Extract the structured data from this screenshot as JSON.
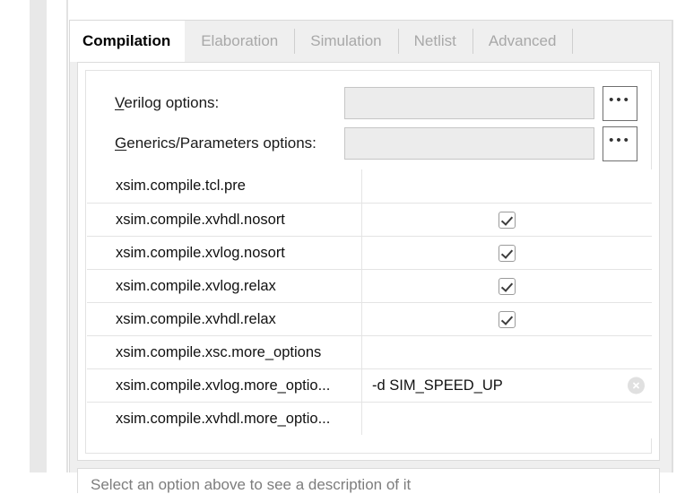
{
  "tabs": [
    {
      "label": "Compilation",
      "active": true
    },
    {
      "label": "Elaboration",
      "active": false
    },
    {
      "label": "Simulation",
      "active": false
    },
    {
      "label": "Netlist",
      "active": false
    },
    {
      "label": "Advanced",
      "active": false
    }
  ],
  "form": {
    "verilog": {
      "label_accel": "V",
      "label_rest": "erilog options:",
      "value": "",
      "browse_label": "•••"
    },
    "generics": {
      "label_accel": "G",
      "label_rest": "enerics/Parameters options:",
      "value": "",
      "browse_label": "•••"
    }
  },
  "properties": {
    "rows": [
      {
        "name": "xsim.compile.tcl.pre",
        "value": "",
        "type": "text",
        "clearable": false
      },
      {
        "name": "xsim.compile.xvhdl.nosort",
        "value": "",
        "type": "checkbox",
        "checked": true,
        "clearable": false
      },
      {
        "name": "xsim.compile.xvlog.nosort",
        "value": "",
        "type": "checkbox",
        "checked": true,
        "clearable": false
      },
      {
        "name": "xsim.compile.xvlog.relax",
        "value": "",
        "type": "checkbox",
        "checked": true,
        "clearable": false
      },
      {
        "name": "xsim.compile.xvhdl.relax",
        "value": "",
        "type": "checkbox",
        "checked": true,
        "clearable": false
      },
      {
        "name": "xsim.compile.xsc.more_options",
        "value": "",
        "type": "text",
        "clearable": false
      },
      {
        "name": "xsim.compile.xvlog.more_optio...",
        "value": "-d SIM_SPEED_UP",
        "type": "text",
        "clearable": true
      },
      {
        "name": "xsim.compile.xvhdl.more_optio...",
        "value": "",
        "type": "text",
        "clearable": false
      }
    ]
  },
  "description": {
    "text": "Select an option above to see a description of it"
  },
  "colors": {
    "active_tab_text": "#000000",
    "inactive_tab_text": "#a8a8a8",
    "panel_bg": "#efefef",
    "content_bg": "#ffffff",
    "field_bg": "#ececec",
    "description_text": "#7d7d7d"
  }
}
